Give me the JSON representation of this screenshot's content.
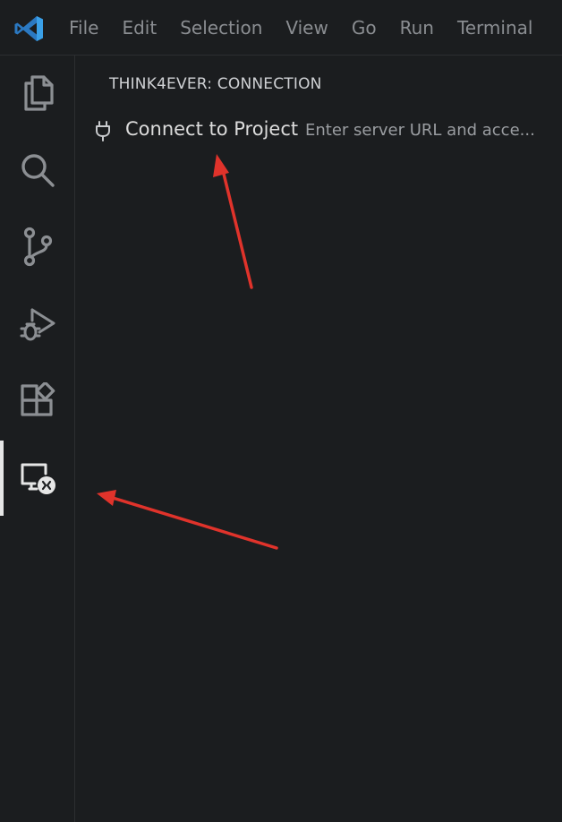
{
  "menu": {
    "items": [
      "File",
      "Edit",
      "Selection",
      "View",
      "Go",
      "Run",
      "Terminal"
    ]
  },
  "activity_bar": {
    "items": [
      {
        "icon": "explorer-icon"
      },
      {
        "icon": "search-icon"
      },
      {
        "icon": "source-control-icon"
      },
      {
        "icon": "run-debug-icon"
      },
      {
        "icon": "extensions-icon"
      },
      {
        "icon": "remote-explorer-icon",
        "active": true
      }
    ]
  },
  "panel": {
    "title": "THINK4EVER: CONNECTION",
    "row": {
      "icon": "plug-icon",
      "label": "Connect to Project",
      "description": "Enter server URL and acce..."
    }
  },
  "colors": {
    "background": "#1b1d1f",
    "logo": "#3aa0e8",
    "annotation_arrow": "#e0332b",
    "active_indicator": "#e6e6e6"
  }
}
